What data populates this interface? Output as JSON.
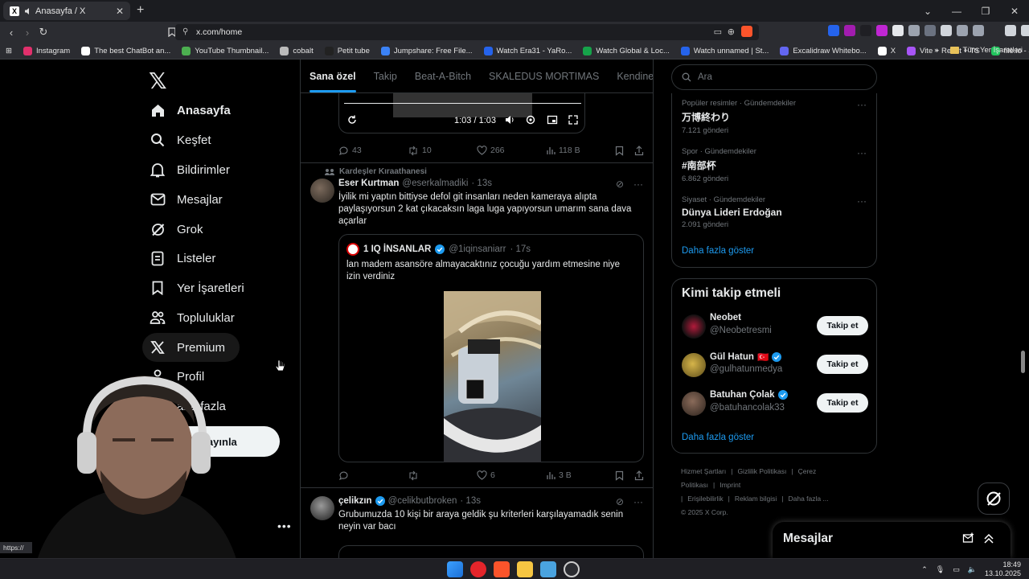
{
  "browser": {
    "tab_title": "Anasayfa / X",
    "url": "x.com/home",
    "new_tab": "+",
    "bookmarks": [
      {
        "label": "Instagram",
        "color": "#e1306c"
      },
      {
        "label": "The best ChatBot an...",
        "color": "#ffffff"
      },
      {
        "label": "YouTube Thumbnail...",
        "color": "#4caf50"
      },
      {
        "label": "cobalt",
        "color": "#bbbbbb"
      },
      {
        "label": "Petit tube",
        "color": "#222222"
      },
      {
        "label": "Jumpshare: Free File...",
        "color": "#3b82f6"
      },
      {
        "label": "Watch Era31 - YaRo...",
        "color": "#2563eb"
      },
      {
        "label": "Watch Global & Loc...",
        "color": "#16a34a"
      },
      {
        "label": "Watch unnamed | St...",
        "color": "#2563eb"
      },
      {
        "label": "Excalidraw Whitebo...",
        "color": "#6366f1"
      },
      {
        "label": "X",
        "color": "#ffffff"
      },
      {
        "label": "Vite + React + TS",
        "color": "#a855f7"
      },
      {
        "label": "file.io - Super simpl...",
        "color": "#22c55e"
      }
    ],
    "all_bookmarks": "Tüm Yer İşaretleri",
    "more_bookmarks": "»"
  },
  "sidebar": {
    "items": [
      {
        "label": "Anasayfa",
        "icon": "home-icon"
      },
      {
        "label": "Keşfet",
        "icon": "search-icon"
      },
      {
        "label": "Bildirimler",
        "icon": "bell-icon"
      },
      {
        "label": "Mesajlar",
        "icon": "mail-icon"
      },
      {
        "label": "Grok",
        "icon": "grok-icon"
      },
      {
        "label": "Listeler",
        "icon": "list-icon"
      },
      {
        "label": "Yer İşaretleri",
        "icon": "bookmark-icon"
      },
      {
        "label": "Topluluklar",
        "icon": "communities-icon"
      },
      {
        "label": "Premium",
        "icon": "x-icon"
      },
      {
        "label": "Profil",
        "icon": "user-icon"
      },
      {
        "label": "aha fazla",
        "icon": "more-icon"
      }
    ],
    "post_button": "eri yayınla",
    "account_more": "•••"
  },
  "feed": {
    "tabs": [
      "Sana özel",
      "Takip",
      "Beat-A-Bitch",
      "SKALEDUS MORTIMAS",
      "Kendine Müz"
    ],
    "video": {
      "time": "1:03 / 1:03"
    },
    "tweet0_actions": {
      "replies": "43",
      "reposts": "10",
      "likes": "266",
      "views": "118 B"
    },
    "tweet1": {
      "context": "Kardeşler Kıraathanesi",
      "name": "Eser Kurtman",
      "handle": "@eserkalmadiki",
      "time": "· 13s",
      "text": "İyilik mi yaptın bittiyse defol git insanları neden kameraya alıpta paylaşıyorsun 2 kat çıkacaksın laga luga yapıyorsun umarım sana dava açarlar",
      "quote": {
        "name": "1 IQ İNSANLAR",
        "handle": "@1iqinsaniarr",
        "time": "· 17s",
        "text": "lan madem asansöre almayacaktınız çocuğu yardım etmesine niye izin verdiniz"
      },
      "actions": {
        "replies": "",
        "reposts": "",
        "likes": "6",
        "views": "3 B"
      }
    },
    "tweet2": {
      "name": "çelikzın",
      "handle": "@celikbutbroken",
      "time": "· 13s",
      "text": "Grubumuzda 10 kişi bir araya geldik şu kriterleri karşılayamadık senin neyin var bacı"
    }
  },
  "right": {
    "search_placeholder": "Ara",
    "trends": [
      {
        "category": "Popüler resimler · Gündemdekiler",
        "name": "万博終わり",
        "count": "7.121 gönderi"
      },
      {
        "category": "Spor · Gündemdekiler",
        "name": "#南部杯",
        "count": "6.862 gönderi"
      },
      {
        "category": "Siyaset · Gündemdekiler",
        "name": "Dünya Lideri Erdoğan",
        "count": "2.091 gönderi"
      }
    ],
    "show_more": "Daha fazla göster",
    "who_to_follow": {
      "title": "Kimi takip etmeli",
      "users": [
        {
          "name": "Neobet",
          "handle": "@Neobetresmi",
          "verified": false,
          "flag": ""
        },
        {
          "name": "Gül Hatun",
          "handle": "@gulhatunmedya",
          "verified": true,
          "flag": "🇹🇷"
        },
        {
          "name": "Batuhan Çolak",
          "handle": "@batuhancolak33",
          "verified": true,
          "flag": ""
        }
      ],
      "follow_label": "Takip et",
      "show_more": "Daha fazla göster"
    },
    "footer": [
      "Hizmet Şartları",
      "|",
      "Gizlilik Politikası",
      "|",
      "Çerez Politikası",
      "|",
      "Imprint",
      "|",
      "Erişilebilirlik",
      "|",
      "Reklam bilgisi",
      "|",
      "Daha fazla ...",
      "© 2025 X Corp."
    ]
  },
  "messages_drawer": {
    "title": "Mesajlar"
  },
  "status_url": "https://",
  "taskbar": {
    "time": "18:49",
    "date": "13.10.2025"
  },
  "colors": {
    "accent": "#1d9bf0",
    "bg": "#000000",
    "border": "#2f3336",
    "muted": "#71767b"
  }
}
